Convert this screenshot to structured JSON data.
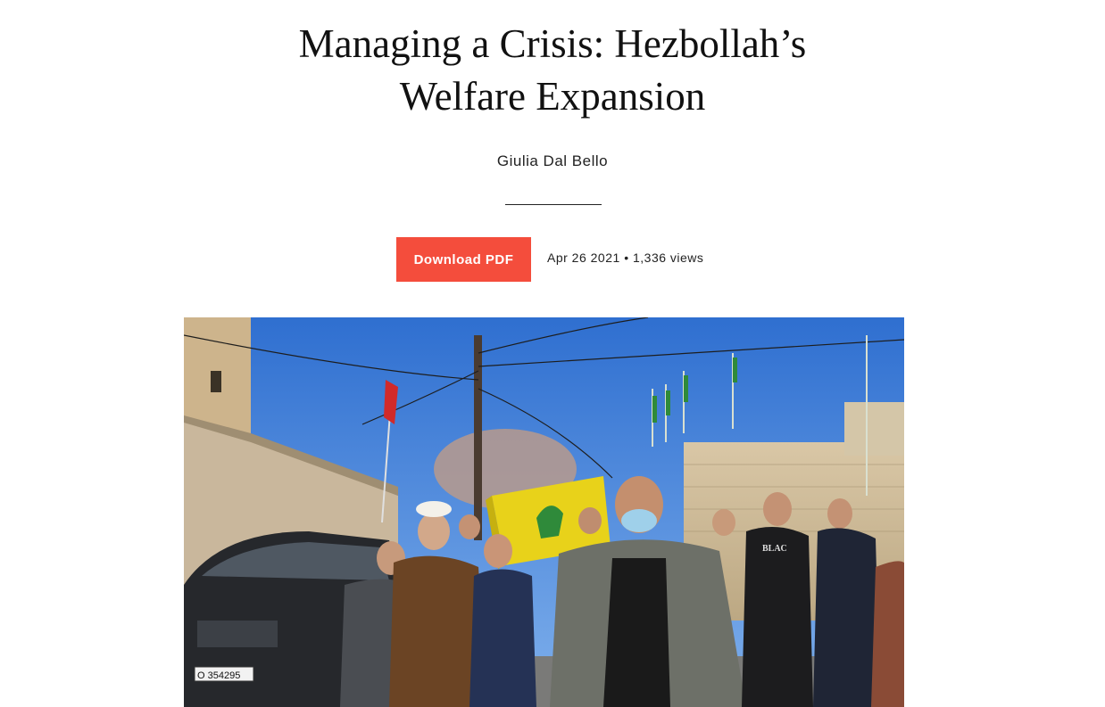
{
  "article": {
    "title_line1": "Managing a Crisis: Hezbollah’s",
    "title_line2": "Welfare Expansion",
    "author": "Giulia Dal Bello",
    "download_label": "Download PDF",
    "date": "Apr 26 2021",
    "separator": "•",
    "views": "1,336 views"
  },
  "hero_photo": {
    "description_icon": "photo-funeral-procession",
    "plate_text": "O 354295",
    "shirt_text": "BLAC"
  },
  "colors": {
    "accent": "#f44d3c",
    "text": "#111111",
    "sky": "#3f7fd8",
    "coffin_flag": "#e8d21a"
  }
}
